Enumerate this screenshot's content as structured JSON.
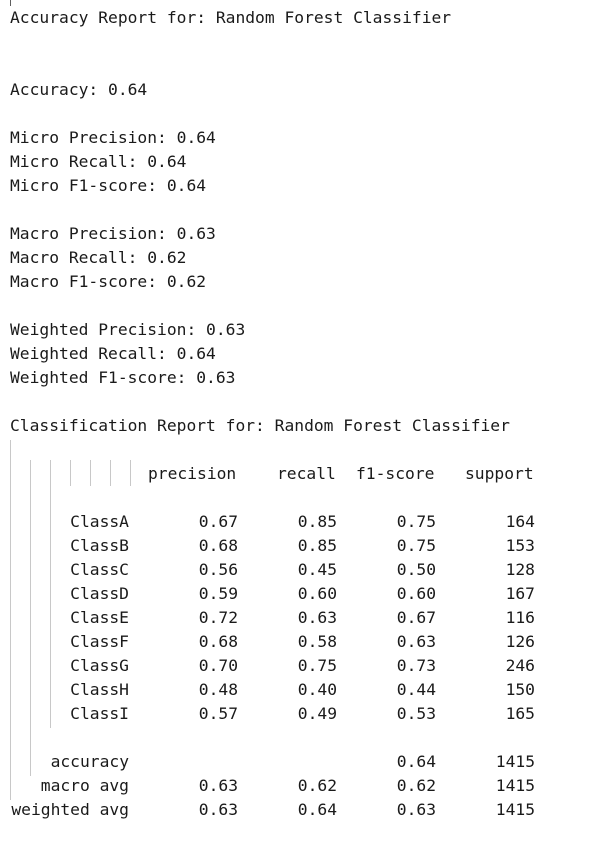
{
  "title_line": "Accuracy Report for: Random Forest Classifier",
  "metrics": [
    "Accuracy: 0.64",
    "Micro Precision: 0.64",
    "Micro Recall: 0.64",
    "Micro F1-score: 0.64",
    "Macro Precision: 0.63",
    "Macro Recall: 0.62",
    "Macro F1-score: 0.62",
    "Weighted Precision: 0.63",
    "Weighted Recall: 0.64",
    "Weighted F1-score: 0.63"
  ],
  "report_title": "Classification Report for: Random Forest Classifier",
  "table": {
    "headers": [
      "precision",
      "recall",
      "f1-score",
      "support"
    ],
    "rows": [
      {
        "label": "ClassA",
        "precision": "0.67",
        "recall": "0.85",
        "f1": "0.75",
        "support": "164"
      },
      {
        "label": "ClassB",
        "precision": "0.68",
        "recall": "0.85",
        "f1": "0.75",
        "support": "153"
      },
      {
        "label": "ClassC",
        "precision": "0.56",
        "recall": "0.45",
        "f1": "0.50",
        "support": "128"
      },
      {
        "label": "ClassD",
        "precision": "0.59",
        "recall": "0.60",
        "f1": "0.60",
        "support": "167"
      },
      {
        "label": "ClassE",
        "precision": "0.72",
        "recall": "0.63",
        "f1": "0.67",
        "support": "116"
      },
      {
        "label": "ClassF",
        "precision": "0.68",
        "recall": "0.58",
        "f1": "0.63",
        "support": "126"
      },
      {
        "label": "ClassG",
        "precision": "0.70",
        "recall": "0.75",
        "f1": "0.73",
        "support": "246"
      },
      {
        "label": "ClassH",
        "precision": "0.48",
        "recall": "0.40",
        "f1": "0.44",
        "support": "150"
      },
      {
        "label": "ClassI",
        "precision": "0.57",
        "recall": "0.49",
        "f1": "0.53",
        "support": "165"
      }
    ],
    "summary": [
      {
        "label": "accuracy",
        "precision": "",
        "recall": "",
        "f1": "0.64",
        "support": "1415"
      },
      {
        "label": "macro avg",
        "precision": "0.63",
        "recall": "0.62",
        "f1": "0.62",
        "support": "1415"
      },
      {
        "label": "weighted avg",
        "precision": "0.63",
        "recall": "0.64",
        "f1": "0.63",
        "support": "1415"
      }
    ]
  },
  "colors": {
    "text": "#1a1a1a",
    "background": "#ffffff",
    "guide_lines": "#c8c8c8"
  }
}
